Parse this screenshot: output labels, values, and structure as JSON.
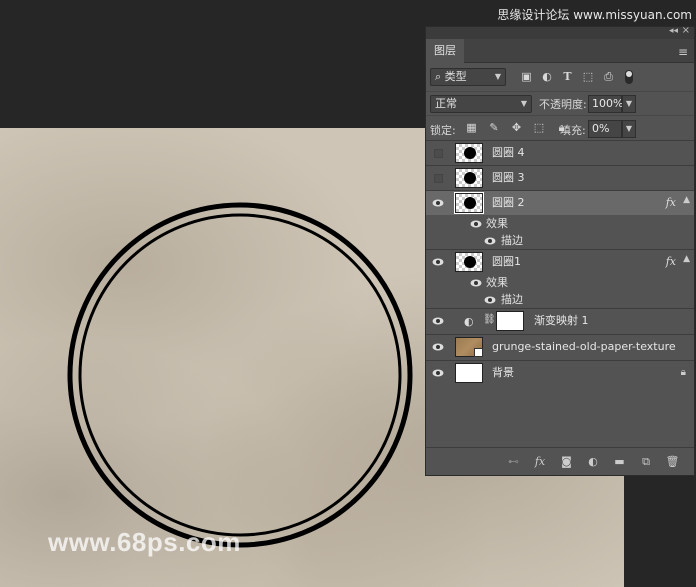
{
  "watermarks": {
    "top": "思缘设计论坛 www.missyuan.com",
    "bottom": "www.68ps.com"
  },
  "panel": {
    "tab_label": "图层",
    "filter": {
      "label": "类型"
    },
    "blend_mode": "正常",
    "opacity_label": "不透明度:",
    "opacity_value": "100%",
    "lock_label": "锁定:",
    "fill_label": "填充:",
    "fill_value": "0%"
  },
  "layers": [
    {
      "name": "圆圈 4",
      "visible": false,
      "type": "shape"
    },
    {
      "name": "圆圈 3",
      "visible": false,
      "type": "shape"
    },
    {
      "name": "圆圈 2",
      "visible": true,
      "type": "shape",
      "selected": true,
      "fx": "fx",
      "effects_label": "效果",
      "effect": "描边"
    },
    {
      "name": "圆圈1",
      "visible": true,
      "type": "shape",
      "fx": "fx",
      "effects_label": "效果",
      "effect": "描边"
    },
    {
      "name": "渐变映射 1",
      "visible": true,
      "type": "adjustment"
    },
    {
      "name": "grunge-stained-old-paper-texture",
      "visible": true,
      "type": "smart-object"
    },
    {
      "name": "背景",
      "visible": true,
      "type": "background",
      "locked": true
    }
  ],
  "icons": {
    "filter": [
      "image-filter-icon",
      "adjustment-filter-icon",
      "type-filter-icon",
      "shape-filter-icon",
      "smart-filter-icon"
    ],
    "lock": [
      "lock-transparent-icon",
      "lock-paint-icon",
      "lock-move-icon",
      "lock-artboard-icon",
      "lock-all-icon"
    ],
    "bottom": [
      "link-icon",
      "fx-icon",
      "mask-icon",
      "adjustment-icon",
      "folder-icon",
      "new-layer-icon",
      "trash-icon"
    ]
  },
  "colors": {
    "panel_bg": "#535353",
    "selected_row": "#696969",
    "canvas": "#cec5b6",
    "app_bg": "#262626"
  }
}
